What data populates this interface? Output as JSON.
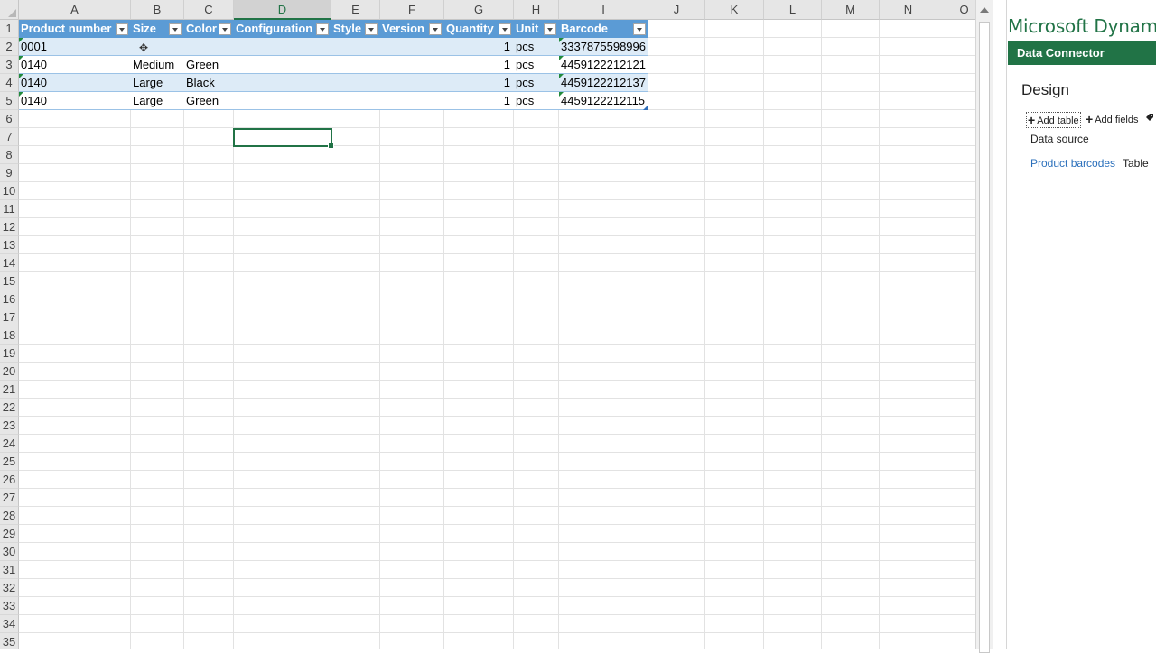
{
  "columns": [
    "A",
    "B",
    "C",
    "D",
    "E",
    "F",
    "G",
    "H",
    "I",
    "J",
    "K",
    "L",
    "M",
    "N",
    "O"
  ],
  "rows": [
    "1",
    "2",
    "3",
    "4",
    "5",
    "6",
    "7",
    "8",
    "9",
    "10",
    "11",
    "12",
    "13",
    "14",
    "15",
    "16",
    "17",
    "18",
    "19",
    "20",
    "21",
    "22",
    "23",
    "24",
    "25",
    "26",
    "27",
    "28",
    "29",
    "30",
    "31",
    "32",
    "33",
    "34",
    "35"
  ],
  "table": {
    "headers": [
      "Product number",
      "Size",
      "Color",
      "Configuration",
      "Style",
      "Version",
      "Quantity",
      "Unit",
      "Barcode"
    ],
    "data": [
      [
        "0001",
        "",
        "",
        "",
        "",
        "",
        "1",
        "pcs",
        "3337875598996"
      ],
      [
        "0140",
        "Medium",
        "Green",
        "",
        "",
        "",
        "1",
        "pcs",
        "4459122212121"
      ],
      [
        "0140",
        "Large",
        "Black",
        "",
        "",
        "",
        "1",
        "pcs",
        "4459122212137"
      ],
      [
        "0140",
        "Large",
        "Green",
        "",
        "",
        "",
        "1",
        "pcs",
        "4459122212115"
      ]
    ]
  },
  "active_cell": "D7",
  "pane": {
    "app_title": "Microsoft Dynamics",
    "section_bar": "Data Connector",
    "heading": "Design",
    "add_table": "Add table",
    "add_fields": "Add fields",
    "data_source_label": "Data source",
    "data_source_table": "Product barcodes",
    "data_source_type": "Table"
  },
  "colors": {
    "excel_green": "#217346",
    "table_header": "#5b9bd5",
    "band": "#ddebf7",
    "link": "#2a6fbb"
  }
}
